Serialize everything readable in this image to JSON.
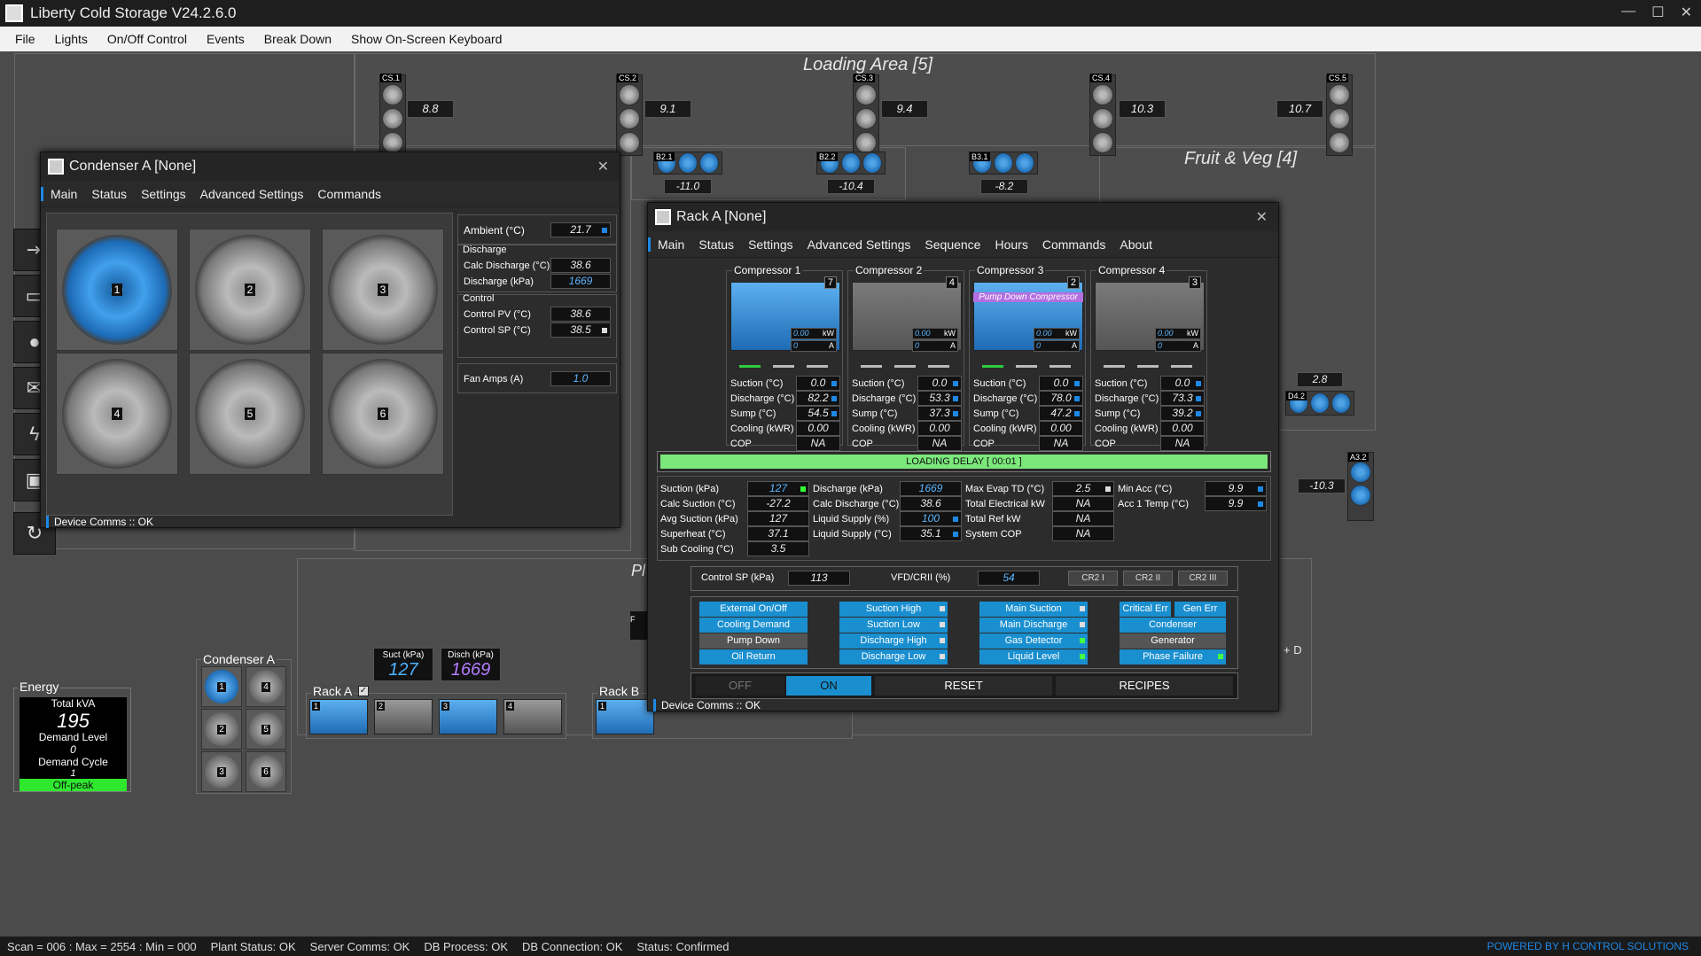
{
  "window": {
    "title": "Liberty Cold Storage V24.2.6.0",
    "controls": [
      "—",
      "☐",
      "✕"
    ]
  },
  "menu": [
    "File",
    "Lights",
    "On/Off Control",
    "Events",
    "Break Down",
    "Show On-Screen Keyboard"
  ],
  "areas": {
    "loading": {
      "title": "Loading Area [5]"
    },
    "fruit": {
      "title": "Fruit & Veg [4]"
    },
    "pl": {
      "title": "Pl"
    },
    "d": {
      "title": "+ D"
    }
  },
  "coldstores": [
    {
      "label": "CS.1",
      "value": "8.8"
    },
    {
      "label": "CS.2",
      "value": "9.1"
    },
    {
      "label": "CS.3",
      "value": "9.4"
    },
    {
      "label": "CS.4",
      "value": "10.3"
    },
    {
      "label": "CS.5",
      "value": "10.7"
    }
  ],
  "units": [
    {
      "label": "B2.1",
      "value": "-11.0"
    },
    {
      "label": "B2.2",
      "value": "-10.4"
    },
    {
      "label": "B3.1",
      "value": "-8.2"
    },
    {
      "label": "D4.2",
      "value": "2.8"
    },
    {
      "label": "A3.2",
      "value": "-10.3"
    }
  ],
  "condenser_window": {
    "title": "Condenser A [None]",
    "tabs": [
      "Main",
      "Status",
      "Settings",
      "Advanced Settings",
      "Commands"
    ],
    "fans": [
      "1",
      "2",
      "3",
      "4",
      "5",
      "6"
    ],
    "ambient_label": "Ambient (°C)",
    "ambient": "21.7",
    "discharge_group": "Discharge",
    "calc_discharge_label": "Calc Discharge (°C)",
    "calc_discharge": "38.6",
    "discharge_kpa_label": "Discharge (kPa)",
    "discharge_kpa": "1669",
    "control_group": "Control",
    "control_pv_label": "Control PV (°C)",
    "control_pv": "38.6",
    "control_sp_label": "Control SP (°C)",
    "control_sp": "38.5",
    "fan_amps_label": "Fan Amps (A)",
    "fan_amps": "1.0",
    "comms": "Device Comms :: OK"
  },
  "rack_window": {
    "title": "Rack A [None]",
    "tabs": [
      "Main",
      "Status",
      "Settings",
      "Advanced Settings",
      "Sequence",
      "Hours",
      "Commands",
      "About"
    ],
    "compressors": [
      {
        "title": "Compressor 1",
        "num": "7",
        "kw": "0.00",
        "kw_unit": "kW",
        "amps": "0",
        "amp_unit": "A",
        "suction": "0.0",
        "discharge": "82.2",
        "sump": "54.5",
        "cooling": "0.00",
        "cop": "NA",
        "pumpdown": ""
      },
      {
        "title": "Compressor 2",
        "num": "4",
        "kw": "0.00",
        "kw_unit": "kW",
        "amps": "0",
        "amp_unit": "A",
        "suction": "0.0",
        "discharge": "53.3",
        "sump": "37.3",
        "cooling": "0.00",
        "cop": "NA",
        "pumpdown": ""
      },
      {
        "title": "Compressor 3",
        "num": "2",
        "kw": "0.00",
        "kw_unit": "kW",
        "amps": "0",
        "amp_unit": "A",
        "suction": "0.0",
        "discharge": "78.0",
        "sump": "47.2",
        "cooling": "0.00",
        "cop": "NA",
        "pumpdown": "Pump Down Compressor"
      },
      {
        "title": "Compressor 4",
        "num": "3",
        "kw": "0.00",
        "kw_unit": "kW",
        "amps": "0",
        "amp_unit": "A",
        "suction": "0.0",
        "discharge": "73.3",
        "sump": "39.2",
        "cooling": "0.00",
        "cop": "NA",
        "pumpdown": ""
      }
    ],
    "comp_labels": {
      "suction": "Suction (°C)",
      "discharge": "Discharge (°C)",
      "sump": "Sump (°C)",
      "cooling": "Cooling (kWR)",
      "cop": "COP"
    },
    "loading_delay": "LOADING DELAY [ 00:01 ]",
    "summary": {
      "suction_kpa_l": "Suction (kPa)",
      "suction_kpa": "127",
      "calc_suction_l": "Calc Suction (°C)",
      "calc_suction": "-27.2",
      "avg_suction_l": "Avg Suction (kPa)",
      "avg_suction": "127",
      "superheat_l": "Superheat (°C)",
      "superheat": "37.1",
      "subcool_l": "Sub Cooling (°C)",
      "subcool": "3.5",
      "discharge_kpa_l": "Discharge (kPa)",
      "discharge_kpa": "1669",
      "calc_discharge_l": "Calc Discharge (°C)",
      "calc_discharge": "38.6",
      "liquid_pct_l": "Liquid Supply (%)",
      "liquid_pct": "100",
      "liquid_c_l": "Liquid Supply (°C)",
      "liquid_c": "35.1",
      "max_evap_l": "Max Evap TD (°C)",
      "max_evap": "2.5",
      "total_elec_l": "Total Electrical kW",
      "total_elec": "NA",
      "total_ref_l": "Total Ref kW",
      "total_ref": "NA",
      "sys_cop_l": "System COP",
      "sys_cop": "NA",
      "min_acc_l": "Min Acc (°C)",
      "min_acc": "9.9",
      "acc1_l": "Acc 1 Temp (°C)",
      "acc1": "9.9"
    },
    "control_sp_label": "Control SP (kPa)",
    "control_sp": "113",
    "vfd_label": "VFD/CRII (%)",
    "vfd": "54",
    "cr2": [
      "CR2 I",
      "CR2 II",
      "CR2 III"
    ],
    "alarms": {
      "col1": [
        "External On/Off",
        "Cooling Demand",
        "Pump Down",
        "Oil Return"
      ],
      "col2": [
        "Suction High",
        "Suction Low",
        "Discharge High",
        "Discharge Low"
      ],
      "col3": [
        "Main Suction",
        "Main Discharge",
        "Gas Detector",
        "Liquid Level"
      ],
      "col4a": [
        "Critical Err",
        "Gen Err"
      ],
      "col4": [
        "Condenser",
        "Generator",
        "Phase Failure"
      ]
    },
    "off": "OFF",
    "on": "ON",
    "reset": "RESET",
    "recipes": "RECIPES",
    "comms": "Device Comms :: OK"
  },
  "energy": {
    "title": "Energy",
    "total_kva_l": "Total kVA",
    "total_kva": "195",
    "demand_level_l": "Demand Level",
    "demand_level": "0",
    "demand_cycle_l": "Demand Cycle",
    "demand_cycle": "1",
    "tariff": "Off-peak"
  },
  "condenser_mini": {
    "title": "Condenser A",
    "fans": [
      "1",
      "4",
      "2",
      "5",
      "3",
      "6"
    ]
  },
  "pressures": {
    "suct_l": "Suct (kPa)",
    "suct": "127",
    "disch_l": "Disch (kPa)",
    "disch": "1669"
  },
  "racks": [
    {
      "label": "Rack A",
      "comps": [
        "1",
        "2",
        "3",
        "4"
      ]
    },
    {
      "label": "Rack B",
      "comps": [
        "1"
      ]
    }
  ],
  "misc": {
    "f_label": "F"
  },
  "statusbar": {
    "scan": "Scan = 006 : Max = 2554 : Min = 000",
    "plant": "Plant Status: OK",
    "server": "Server Comms: OK",
    "dbproc": "DB Process:  OK",
    "dbconn": "DB Connection:  OK",
    "status": "Status:  Confirmed",
    "powered": "POWERED BY H CONTROL SOLUTIONS"
  }
}
